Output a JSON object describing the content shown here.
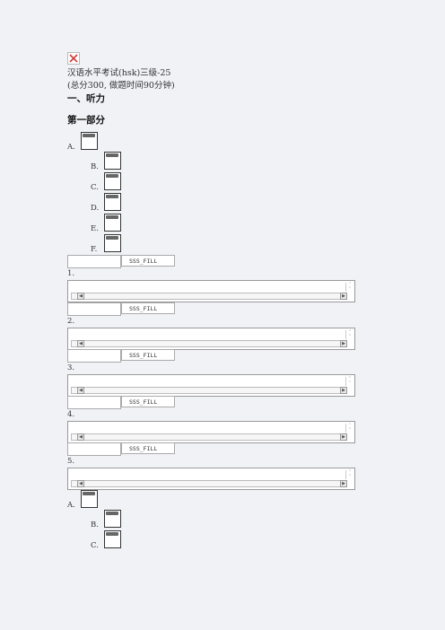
{
  "header": {
    "title": "汉语水平考试(hsk)三级-25",
    "subtitle": "(总分300, 做题时间90分钟)"
  },
  "section1": {
    "heading": "一、听力"
  },
  "part1": {
    "heading": "第一部分"
  },
  "options_top": [
    {
      "label": "A."
    },
    {
      "label": "B."
    },
    {
      "label": "C."
    },
    {
      "label": "D."
    },
    {
      "label": "E."
    },
    {
      "label": "F."
    }
  ],
  "fill_tag": "SSS_FILL",
  "questions": [
    {
      "num": "1."
    },
    {
      "num": "2."
    },
    {
      "num": "3."
    },
    {
      "num": "4."
    },
    {
      "num": "5."
    }
  ],
  "options_bottom": [
    {
      "label": "A."
    },
    {
      "label": "B."
    },
    {
      "label": "C."
    }
  ],
  "icons": {
    "broken_image": "broken-image-icon",
    "scroll_left": "arrow-left-icon",
    "scroll_right": "arrow-right-icon",
    "scroll_up": "arrow-up-icon",
    "scroll_down": "arrow-down-icon"
  },
  "colors": {
    "background": "#f1f2f6",
    "broken_icon": "#d23b3b"
  }
}
